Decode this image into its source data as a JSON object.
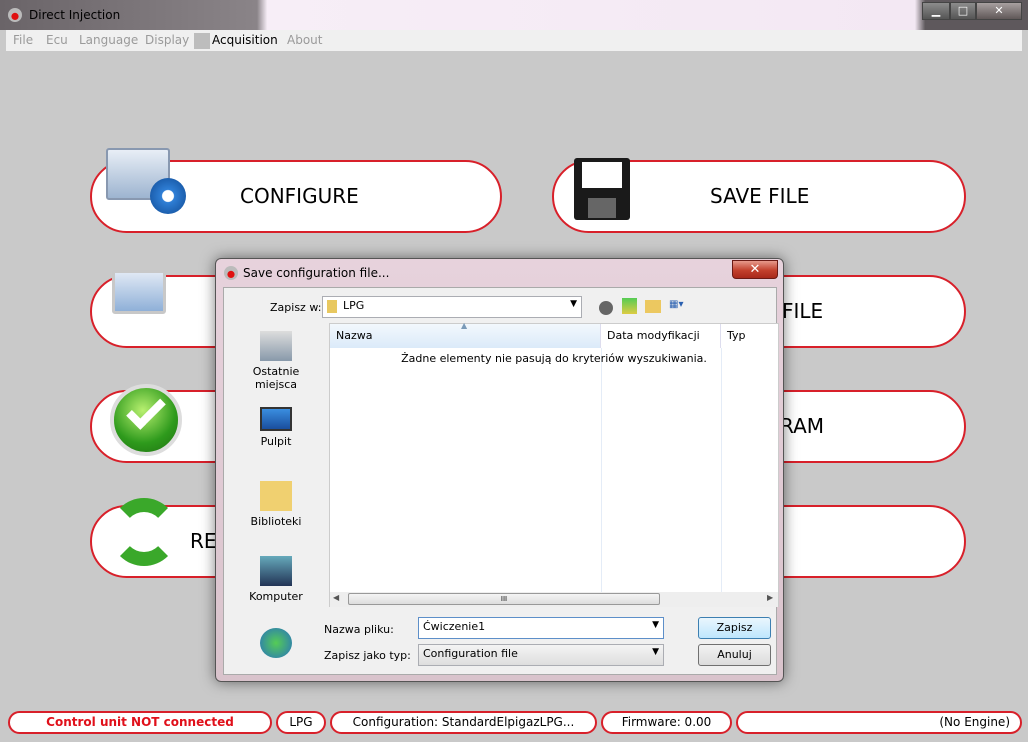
{
  "window": {
    "title": "Direct Injection",
    "minimize": "▁",
    "maximize": "□",
    "close": "✕"
  },
  "menu": [
    "File",
    "Ecu",
    "Language",
    "Display",
    "Acquisition",
    "About"
  ],
  "buttons": {
    "configure": "CONFIGURE",
    "save_file": "SAVE FILE",
    "row2_right": "FILE",
    "row3_right": "RAM",
    "row4_left": "RE"
  },
  "dialog": {
    "title": "Save configuration file...",
    "close": "✕",
    "save_in_label": "Zapisz w:",
    "save_in_value": "LPG",
    "places": [
      "Ostatnie miejsca",
      "Pulpit",
      "Biblioteki",
      "Komputer"
    ],
    "columns": [
      "Nazwa",
      "Data modyfikacji",
      "Typ"
    ],
    "empty_message": "Żadne elementy nie pasują do kryteriów wyszukiwania.",
    "filename_label": "Nazwa pliku:",
    "filename_value": "Ćwiczenie1",
    "filetype_label": "Zapisz jako typ:",
    "filetype_value": "Configuration file",
    "save": "Zapisz",
    "cancel": "Anuluj",
    "scroll_grip": "III"
  },
  "status": {
    "connection": "Control unit NOT connected",
    "fuel": "LPG",
    "configuration": "Configuration: StandardElpigazLPG...",
    "firmware": "Firmware: 0.00",
    "engine": "(No Engine)"
  },
  "colors": {
    "accent": "#d8202a",
    "status_error": "#e0101a"
  }
}
